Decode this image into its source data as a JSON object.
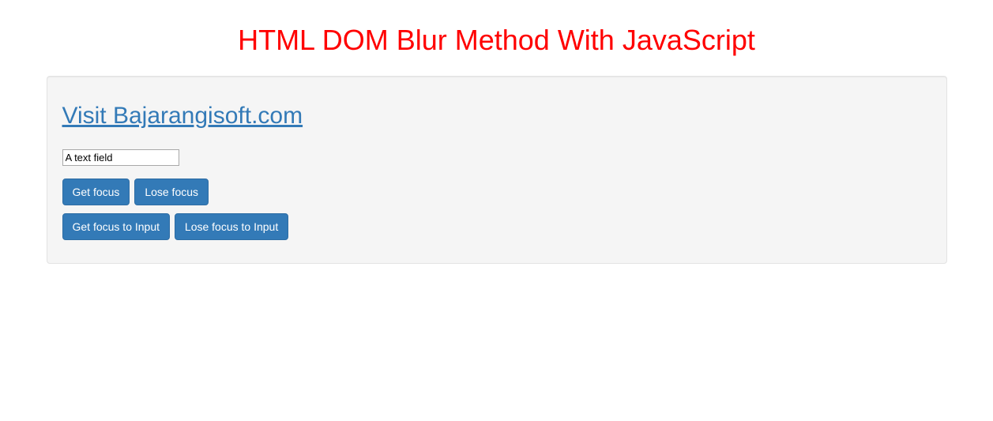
{
  "header": {
    "title": "HTML DOM Blur Method With JavaScript"
  },
  "panel": {
    "link_text": "Visit Bajarangisoft.com",
    "input": {
      "value": "A text field"
    },
    "buttons_row1": {
      "get_focus": "Get focus",
      "lose_focus": "Lose focus"
    },
    "buttons_row2": {
      "get_focus_input": "Get focus to Input",
      "lose_focus_input": "Lose focus to Input"
    }
  }
}
